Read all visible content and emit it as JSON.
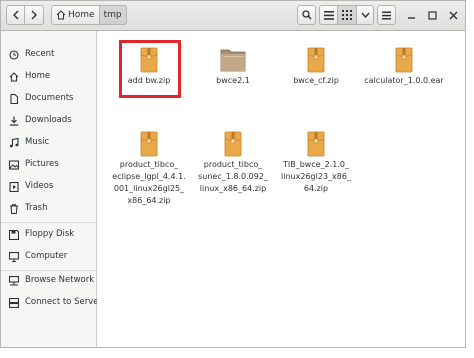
{
  "breadcrumb": {
    "home": "Home",
    "current": "tmp"
  },
  "sidebar": {
    "items": [
      {
        "label": "Recent",
        "icon": "clock-icon"
      },
      {
        "label": "Home",
        "icon": "home-icon"
      },
      {
        "label": "Documents",
        "icon": "document-icon"
      },
      {
        "label": "Downloads",
        "icon": "download-icon"
      },
      {
        "label": "Music",
        "icon": "music-icon"
      },
      {
        "label": "Pictures",
        "icon": "picture-icon"
      },
      {
        "label": "Videos",
        "icon": "video-icon"
      },
      {
        "label": "Trash",
        "icon": "trash-icon"
      },
      {
        "label": "Floppy Disk",
        "icon": "floppy-disk-icon"
      },
      {
        "label": "Computer",
        "icon": "computer-icon"
      },
      {
        "label": "Browse Network",
        "icon": "network-icon"
      },
      {
        "label": "Connect to Server",
        "icon": "server-icon"
      }
    ]
  },
  "files": [
    {
      "lines": [
        "add bw.zip"
      ],
      "type": "archive-icon"
    },
    {
      "lines": [
        "bwce2.1"
      ],
      "type": "folder-icon"
    },
    {
      "lines": [
        "bwce_cf.zip"
      ],
      "type": "archive-icon"
    },
    {
      "lines": [
        "calculator_1.0.0.ear"
      ],
      "type": "archive-icon"
    },
    {
      "lines": [
        "product_tibco_",
        "eclipse_lgpl_4.4.1.",
        "001_linux26gl25_",
        "x86_64.zip"
      ],
      "type": "archive-icon"
    },
    {
      "lines": [
        "product_tibco_",
        "sunec_1.8.0.092_",
        "linux_x86_64.zip"
      ],
      "type": "archive-icon"
    },
    {
      "lines": [
        "TIB_bwce_2.1.0_",
        "linux26gl23_x86_",
        "64.zip"
      ],
      "type": "archive-icon"
    }
  ],
  "colors": {
    "highlight": "#e1252c",
    "archive": "#e9a94a",
    "folder": "#a88c6c"
  }
}
